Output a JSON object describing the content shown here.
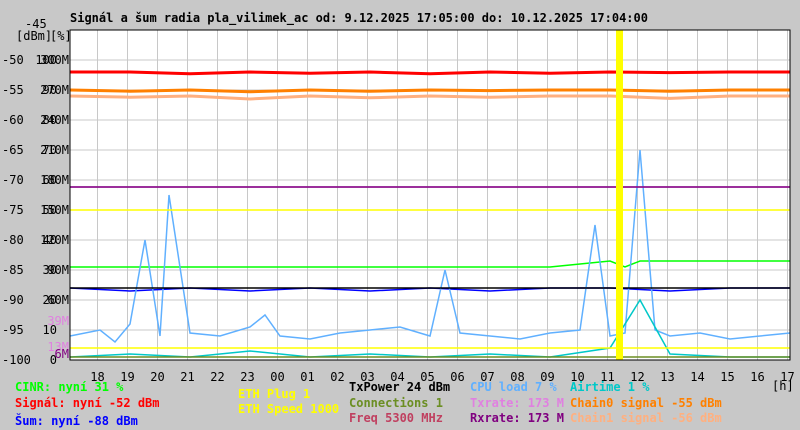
{
  "chart_data": {
    "type": "line",
    "title": "Signál a šum radia pla_vilimek_ac od: 9.12.2025 17:05:00 do: 10.12.2025 17:04:00",
    "y_units": [
      "[dBm]",
      "[%]"
    ],
    "y_ticks_dbm": [
      -45,
      -50,
      -55,
      -60,
      -65,
      -70,
      -75,
      -80,
      -85,
      -90,
      -95,
      -100
    ],
    "y_ticks_pct": [
      100,
      90,
      80,
      70,
      60,
      50,
      40,
      30,
      20,
      10,
      0
    ],
    "y_ticks_rate": [
      "300M",
      "270M",
      "240M",
      "210M",
      "180M",
      "150M",
      "120M",
      "90M",
      "60M"
    ],
    "rate_markers": [
      {
        "label": "39M",
        "color": "#e080e0"
      },
      {
        "label": "13M",
        "color": "#e080e0"
      },
      {
        "label": "6M",
        "color": "#800080"
      }
    ],
    "x_ticks": [
      "18",
      "19",
      "20",
      "21",
      "22",
      "23",
      "00",
      "01",
      "02",
      "03",
      "04",
      "05",
      "06",
      "07",
      "08",
      "09",
      "10",
      "11",
      "12",
      "13",
      "14",
      "15",
      "16",
      "17"
    ],
    "x_unit": "[h]",
    "xlim_hours": [
      0,
      24
    ],
    "marker_hour": 18.3,
    "series": [
      {
        "name": "Signál",
        "axis": "dBm",
        "color": "#ff0000",
        "x": [
          0,
          2,
          4,
          6,
          8,
          10,
          12,
          14,
          16,
          18,
          20,
          22,
          24
        ],
        "y": [
          -52,
          -52,
          -52.3,
          -52,
          -52.2,
          -52,
          -52.3,
          -52,
          -52.2,
          -52,
          -52.1,
          -52,
          -52
        ]
      },
      {
        "name": "Chain0 signal",
        "axis": "dBm",
        "color": "#ff8000",
        "x": [
          0,
          2,
          4,
          6,
          8,
          10,
          12,
          14,
          16,
          18,
          20,
          22,
          24
        ],
        "y": [
          -55,
          -55.2,
          -55,
          -55.3,
          -55,
          -55.2,
          -55,
          -55.1,
          -55,
          -55,
          -55.2,
          -55,
          -55
        ]
      },
      {
        "name": "Chain1 signal",
        "axis": "dBm",
        "color": "#ffb080",
        "x": [
          0,
          2,
          4,
          6,
          8,
          10,
          12,
          14,
          16,
          18,
          20,
          22,
          24
        ],
        "y": [
          -56,
          -56.2,
          -56,
          -56.5,
          -56,
          -56.3,
          -56,
          -56.2,
          -56,
          -56,
          -56.4,
          -56,
          -56
        ]
      },
      {
        "name": "Šum",
        "axis": "dBm",
        "color": "#0000ff",
        "x": [
          0,
          2,
          4,
          6,
          8,
          10,
          12,
          14,
          16,
          18,
          20,
          22,
          24
        ],
        "y": [
          -88,
          -88.5,
          -88,
          -88.5,
          -88,
          -88.5,
          -88,
          -88.5,
          -88,
          -88,
          -88.5,
          -88,
          -88
        ]
      },
      {
        "name": "CINR",
        "axis": "pct",
        "color": "#00ff00",
        "x": [
          0,
          2,
          4,
          6,
          8,
          10,
          12,
          14,
          16,
          17,
          18,
          18.5,
          19,
          20,
          22,
          24
        ],
        "y": [
          31,
          31,
          31,
          31,
          31,
          31,
          31,
          31,
          31,
          32,
          33,
          31,
          33,
          33,
          33,
          33
        ]
      },
      {
        "name": "CPU load",
        "axis": "pct",
        "color": "#60b0ff",
        "x": [
          0,
          1,
          1.5,
          2,
          2.5,
          3,
          3.3,
          4,
          5,
          6,
          6.5,
          7,
          8,
          9,
          10,
          11,
          12,
          12.5,
          13,
          14,
          15,
          16,
          17,
          17.5,
          18,
          18.5,
          19,
          19.5,
          20,
          21,
          22,
          23,
          24
        ],
        "y": [
          8,
          10,
          6,
          12,
          40,
          8,
          55,
          9,
          8,
          11,
          15,
          8,
          7,
          9,
          10,
          11,
          8,
          30,
          9,
          8,
          7,
          9,
          10,
          45,
          8,
          9,
          70,
          10,
          8,
          9,
          7,
          8,
          9
        ]
      },
      {
        "name": "Airtime",
        "axis": "pct",
        "color": "#00c8c8",
        "x": [
          0,
          2,
          4,
          6,
          8,
          10,
          12,
          14,
          16,
          18,
          19,
          20,
          22,
          24
        ],
        "y": [
          1,
          2,
          1,
          3,
          1,
          2,
          1,
          2,
          1,
          4,
          20,
          2,
          1,
          1
        ]
      },
      {
        "name": "Txrate",
        "axis": "rate",
        "color": "#e080e0",
        "x": [
          0,
          2,
          4,
          6,
          8,
          10,
          12,
          14,
          16,
          18,
          20,
          22,
          24
        ],
        "y": [
          173,
          173,
          173,
          173,
          173,
          173,
          173,
          173,
          173,
          173,
          173,
          173,
          173
        ]
      },
      {
        "name": "Rxrate",
        "axis": "rate",
        "color": "#800080",
        "x": [
          0,
          24
        ],
        "y": [
          173,
          173
        ]
      },
      {
        "name": "ETH Speed",
        "axis": "pct",
        "color": "#ffff00",
        "x": [
          0,
          24
        ],
        "y": [
          50,
          50
        ]
      },
      {
        "name": "ETH Plug",
        "axis": "pct",
        "color": "#ffff00",
        "x": [
          0,
          24
        ],
        "y": [
          4,
          4
        ]
      },
      {
        "name": "Connections",
        "axis": "pct",
        "color": "#6b8e23",
        "x": [
          0,
          24
        ],
        "y": [
          1,
          1
        ]
      },
      {
        "name": "TxPower",
        "axis": "pct",
        "color": "#000000",
        "x": [
          0,
          24
        ],
        "y": [
          24,
          24
        ]
      }
    ]
  },
  "legend": {
    "cinr": "CINR: nyní 31 %",
    "signal": "Signál: nyní -52 dBm",
    "noise": "Šum: nyní -88 dBm",
    "eth_plug": "ETH Plug 1",
    "eth_speed": "ETH Speed 1000",
    "txpower": "TxPower 24 dBm",
    "connections": "Connections 1",
    "freq": "Freq 5300 MHz",
    "cpu": "CPU load 7 %",
    "txrate": "Txrate: 173 M",
    "rxrate": "Rxrate: 173 M",
    "airtime": "Airtime 1 %",
    "chain0": "Chain0 signal -55 dBm",
    "chain1": "Chain1 signal -56 dBm"
  }
}
